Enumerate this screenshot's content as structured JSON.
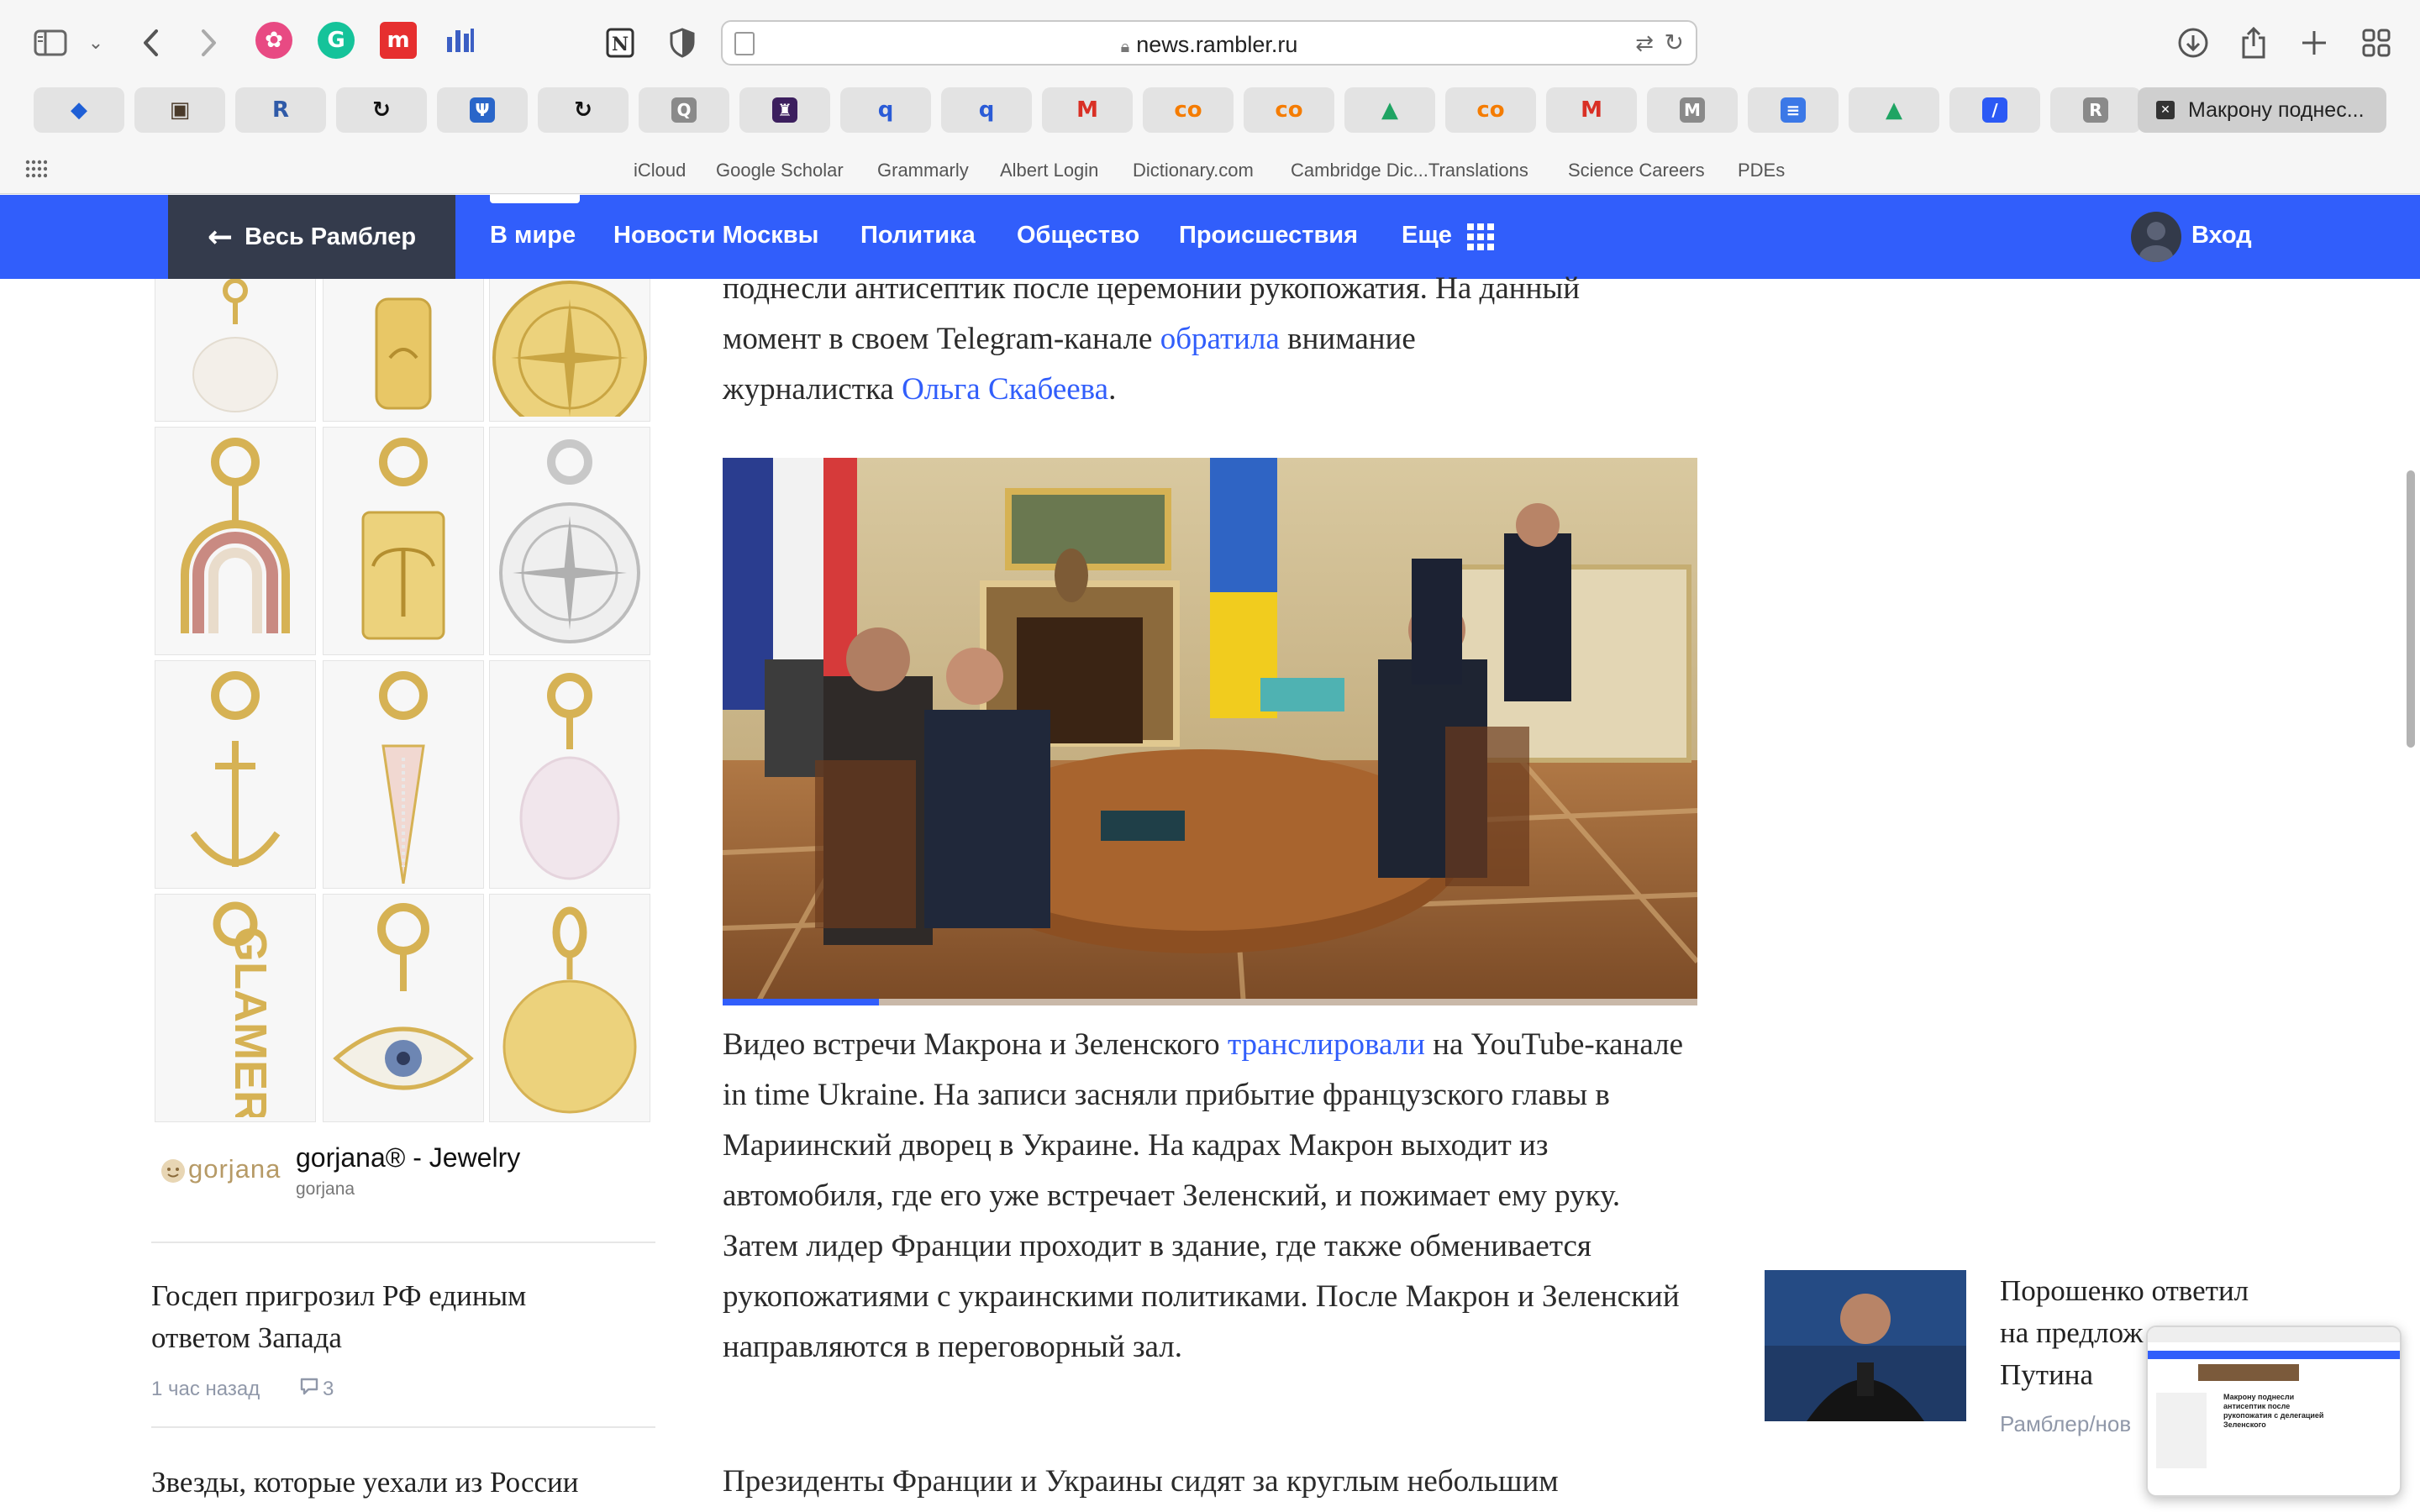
{
  "browser": {
    "url": "news.rambler.ru",
    "active_tab_title": "Макрону поднес...",
    "tabs": [
      {
        "icon": "layers-icon",
        "glyph": "◆",
        "color": "#1f5fd6"
      },
      {
        "icon": "photo-icon",
        "glyph": "▣",
        "color": "#4a3a2a"
      },
      {
        "icon": "r-icon",
        "glyph": "R",
        "color": "#2f5aa8"
      },
      {
        "icon": "refresh-icon",
        "glyph": "↻",
        "color": "#111111"
      },
      {
        "icon": "psi-icon",
        "glyph": "Ψ",
        "color": "#ffffff",
        "bg": "#2a66c9"
      },
      {
        "icon": "refresh-icon",
        "glyph": "↻",
        "color": "#111111"
      },
      {
        "icon": "q-icon",
        "glyph": "Q",
        "color": "#ffffff",
        "bg": "#8a8a8a"
      },
      {
        "icon": "lantern-icon",
        "glyph": "♜",
        "color": "#ffffff",
        "bg": "#3c1f5e"
      },
      {
        "icon": "q-icon",
        "glyph": "q",
        "color": "#2a5bd7"
      },
      {
        "icon": "q-icon",
        "glyph": "q",
        "color": "#2a5bd7"
      },
      {
        "icon": "gmail-icon",
        "glyph": "M",
        "color": "#d93025"
      },
      {
        "icon": "co-icon",
        "glyph": "co",
        "color": "#f57c00"
      },
      {
        "icon": "co-icon",
        "glyph": "co",
        "color": "#f57c00"
      },
      {
        "icon": "drive-icon",
        "glyph": "▲",
        "color": "#1fa463"
      },
      {
        "icon": "co-icon",
        "glyph": "co",
        "color": "#f57c00"
      },
      {
        "icon": "gmail-icon",
        "glyph": "M",
        "color": "#d93025"
      },
      {
        "icon": "m-icon",
        "glyph": "M",
        "color": "#ffffff",
        "bg": "#8a8a8a"
      },
      {
        "icon": "docs-icon",
        "glyph": "≡",
        "color": "#ffffff",
        "bg": "#3b78e7"
      },
      {
        "icon": "drive-icon",
        "glyph": "▲",
        "color": "#1fa463"
      },
      {
        "icon": "slash-icon",
        "glyph": "/",
        "color": "#ffffff",
        "bg": "#2b59f5"
      },
      {
        "icon": "r-icon",
        "glyph": "R",
        "color": "#ffffff",
        "bg": "#8a8a8a"
      }
    ],
    "favorites": [
      "iCloud",
      "Google Scholar",
      "Grammarly",
      "Albert Login",
      "Dictionary.com",
      "Cambridge Dic...Translations",
      "Science Careers",
      "PDEs"
    ]
  },
  "nav": {
    "back_label": "Весь Рамблер",
    "items": [
      "В мире",
      "Новости Москвы",
      "Политика",
      "Общество",
      "Происшествия",
      "Еще"
    ],
    "login_label": "Вход"
  },
  "ad": {
    "brand_logo": "gorjana",
    "title": "gorjana® - Jewelry",
    "advertiser": "gorjana"
  },
  "sidebar_news": [
    {
      "title": "Госдеп пригрозил РФ единым ответом Запада",
      "time": "1 час назад",
      "comments": "3"
    },
    {
      "title": "Звезды, которые уехали из России"
    }
  ],
  "article": {
    "p1_lines": [
      "поднесли антисептик после церемонии рукопожатия. На данный",
      "момент в своем Telegram-канале "
    ],
    "p1_link1": "обратила",
    "p1_after1": " внимание",
    "p1_line3": "журналистка ",
    "p1_link2": "Ольга Скабеева",
    "p1_end": ".",
    "p2_start": "Видео встречи Макрона и Зеленского ",
    "p2_link": "транслировали",
    "p2_rest": " на YouTube-канале in time Ukraine. На записи засняли прибытие французского главы в Мариинский дворец в Украине. На кадрах Макрон выходит из автомобиля, где его уже встречает Зеленский, и пожимает ему руку. Затем лидер Франции проходит в здание, где также обменивается рукопожатиями с украинскими политиками. После Макрон и Зеленский направляются в переговорный зал.",
    "p3": "Президенты Франции и Украины сидят за круглым небольшим",
    "video_progress": 0.16
  },
  "rail": {
    "card_title_lines": [
      "Порошенко ответил",
      "на предлож",
      "Путина"
    ],
    "card_source": "Рамблер/нов"
  },
  "thumbnail": {
    "label": "Макрону поднесли антисептик после рукопожатия с делегацией Зеленского"
  }
}
